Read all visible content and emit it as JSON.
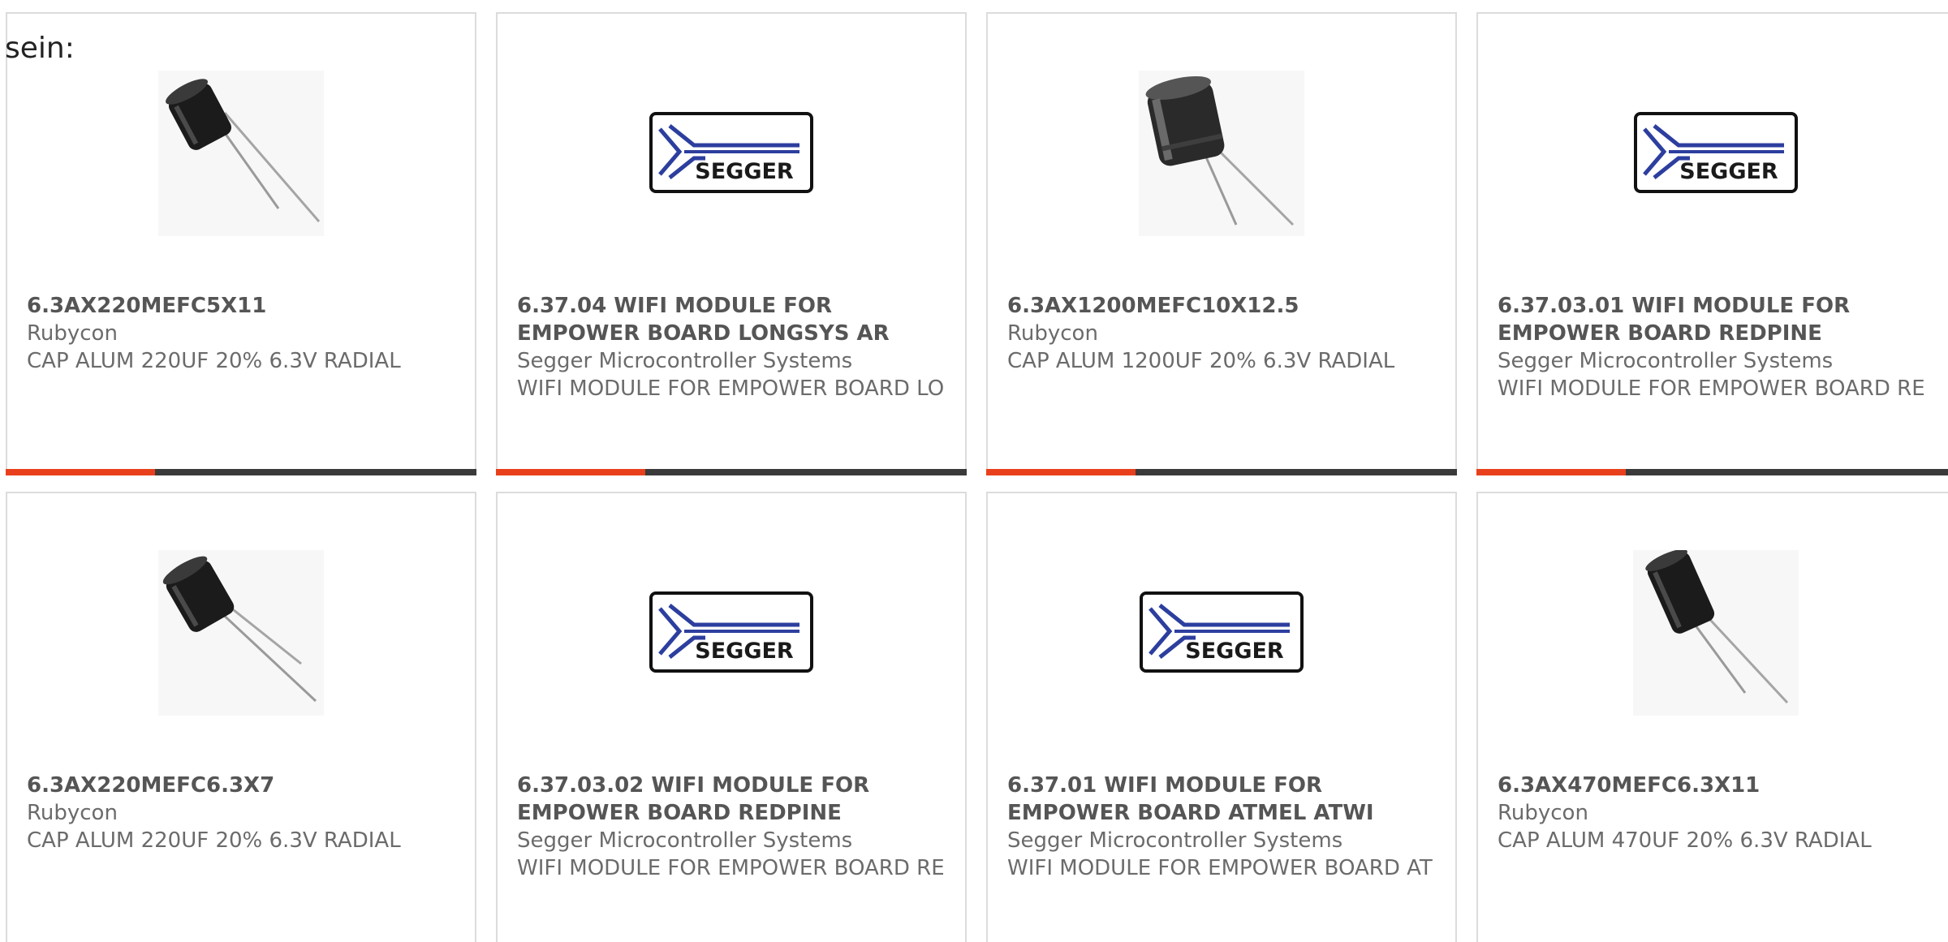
{
  "intro_text": "sein:",
  "colors": {
    "accent": "#e8401c",
    "bar": "#3a3a3a",
    "segger_blue": "#2c3e9e"
  },
  "products": [
    {
      "part_number": "6.3AX220MEFC5X11",
      "manufacturer": "Rubycon",
      "description": "CAP ALUM 220UF 20% 6.3V RADIAL",
      "image_icon": "capacitor-small-icon"
    },
    {
      "part_number": "6.37.04 WIFI MODULE FOR EMPOWER BOARD LONGSYS AR",
      "manufacturer": "Segger Microcontroller Systems",
      "description": "WIFI MODULE FOR EMPOWER BOARD LO",
      "image_icon": "segger-logo",
      "logo_text": "SEGGER"
    },
    {
      "part_number": "6.3AX1200MEFC10X12.5",
      "manufacturer": "Rubycon",
      "description": "CAP ALUM 1200UF 20% 6.3V RADIAL",
      "image_icon": "capacitor-large-icon"
    },
    {
      "part_number": "6.37.03.01 WIFI MODULE FOR EMPOWER BOARD REDPINE",
      "manufacturer": "Segger Microcontroller Systems",
      "description": "WIFI MODULE FOR EMPOWER BOARD RE",
      "image_icon": "segger-logo",
      "logo_text": "SEGGER"
    },
    {
      "part_number": "6.3AX220MEFC6.3X7",
      "manufacturer": "Rubycon",
      "description": "CAP ALUM 220UF 20% 6.3V RADIAL",
      "image_icon": "capacitor-small-icon"
    },
    {
      "part_number": "6.37.03.02 WIFI MODULE FOR EMPOWER BOARD REDPINE",
      "manufacturer": "Segger Microcontroller Systems",
      "description": "WIFI MODULE FOR EMPOWER BOARD RE",
      "image_icon": "segger-logo",
      "logo_text": "SEGGER"
    },
    {
      "part_number": "6.37.01 WIFI MODULE FOR EMPOWER BOARD ATMEL ATWI",
      "manufacturer": "Segger Microcontroller Systems",
      "description": "WIFI MODULE FOR EMPOWER BOARD AT",
      "image_icon": "segger-logo",
      "logo_text": "SEGGER"
    },
    {
      "part_number": "6.3AX470MEFC6.3X11",
      "manufacturer": "Rubycon",
      "description": "CAP ALUM 470UF 20% 6.3V RADIAL",
      "image_icon": "capacitor-tall-icon"
    }
  ]
}
